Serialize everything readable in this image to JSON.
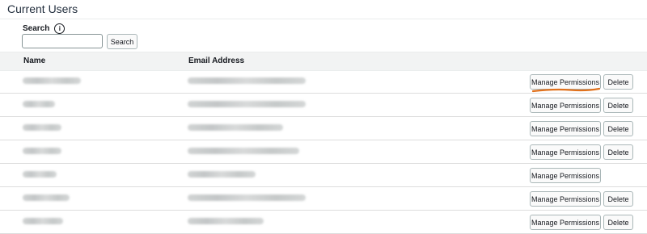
{
  "page": {
    "title": "Current Users"
  },
  "search": {
    "label": "Search",
    "info_glyph": "i",
    "value": "",
    "placeholder": "",
    "button_label": "Search"
  },
  "table": {
    "columns": [
      "Name",
      "Email Address"
    ],
    "rows": [
      {
        "manage_label": "Manage Permissions",
        "delete_label": "Delete",
        "has_delete": true,
        "highlighted": true
      },
      {
        "manage_label": "Manage Permissions",
        "delete_label": "Delete",
        "has_delete": true
      },
      {
        "manage_label": "Manage Permissions",
        "delete_label": "Delete",
        "has_delete": true
      },
      {
        "manage_label": "Manage Permissions",
        "delete_label": "Delete",
        "has_delete": true
      },
      {
        "manage_label": "Manage Permissions",
        "has_delete": false
      },
      {
        "manage_label": "Manage Permissions",
        "delete_label": "Delete",
        "has_delete": true
      },
      {
        "manage_label": "Manage Permissions",
        "delete_label": "Delete",
        "has_delete": true
      }
    ]
  },
  "colors": {
    "annotation_underline": "#e0711c"
  }
}
